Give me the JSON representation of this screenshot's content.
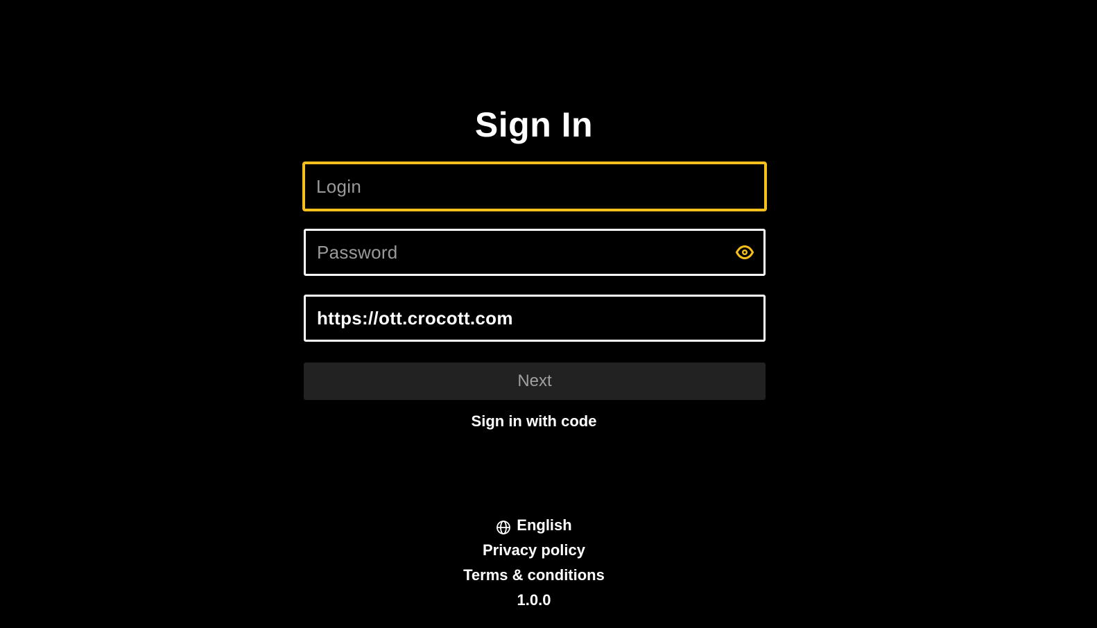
{
  "page": {
    "title": "Sign In"
  },
  "form": {
    "login": {
      "placeholder": "Login",
      "value": ""
    },
    "password": {
      "placeholder": "Password",
      "value": "",
      "toggle_icon": "eye-icon"
    },
    "server": {
      "placeholder": "",
      "value": "https://ott.crocott.com"
    },
    "next_label": "Next",
    "code_link": "Sign in with code"
  },
  "footer": {
    "language_icon": "globe-icon",
    "language": "English",
    "privacy": "Privacy policy",
    "terms": "Terms & conditions",
    "version": "1.0.0"
  },
  "colors": {
    "background": "#000000",
    "accent": "#f5bf1e",
    "button_bg": "#222222",
    "button_text": "#a0a0a0"
  }
}
